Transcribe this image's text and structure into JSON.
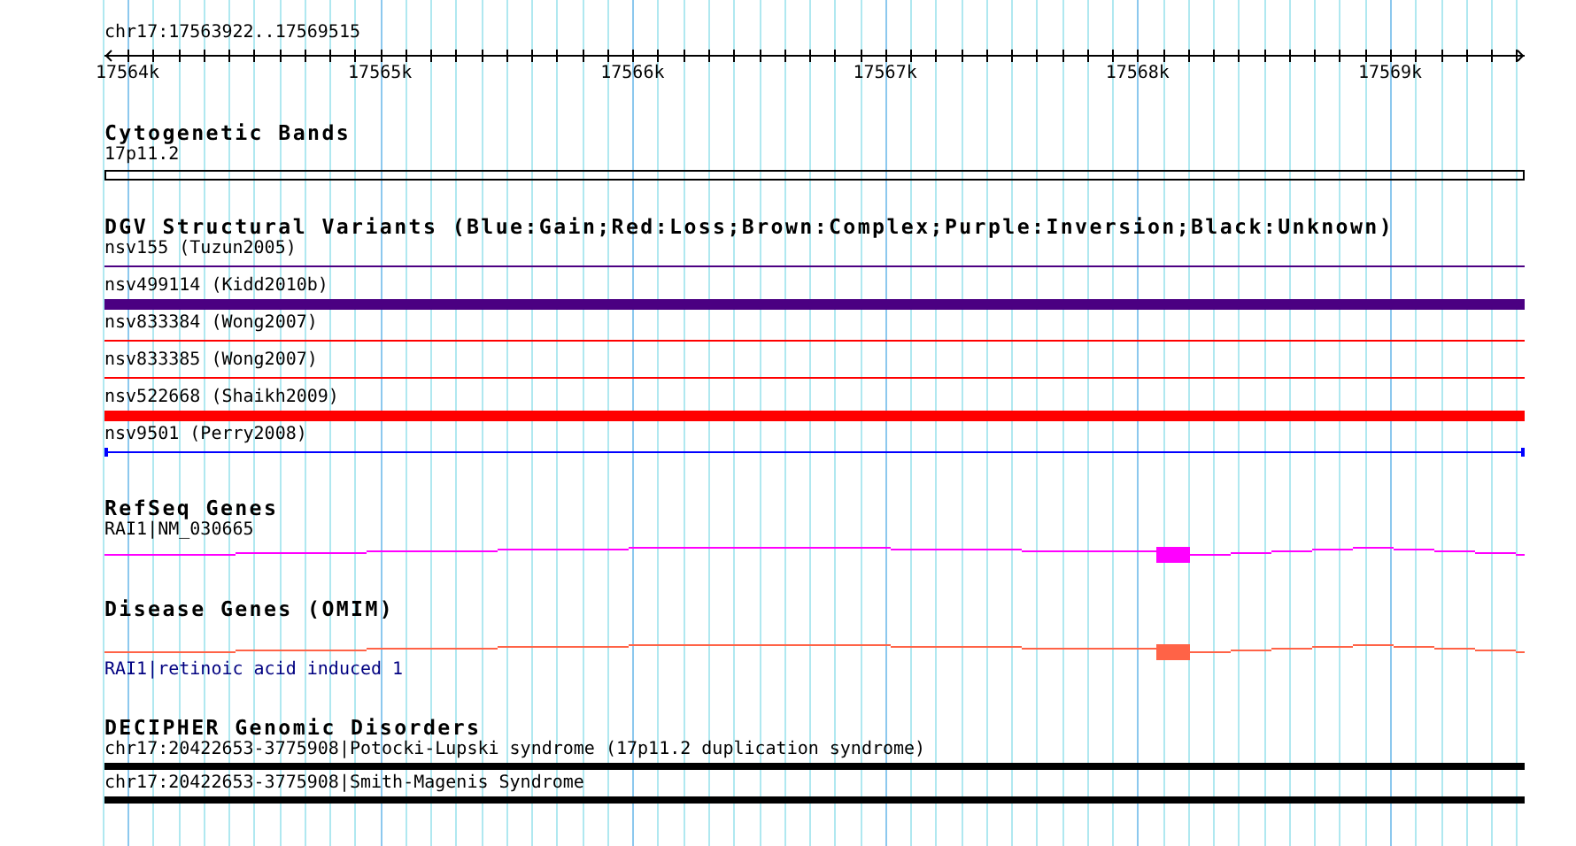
{
  "ruler": {
    "label": "chr17:17563922..17569515",
    "ticks": [
      "17564k",
      "17565k",
      "17566k",
      "17567k",
      "17568k",
      "17569k"
    ]
  },
  "tracks": [
    {
      "title": "Cytogenetic Bands",
      "features": [
        {
          "kind": "band",
          "label": "17p11.2",
          "color": "#000000"
        }
      ]
    },
    {
      "title": "DGV Structural Variants (Blue:Gain;Red:Loss;Brown:Complex;Purple:Inversion;Black:Unknown)",
      "features": [
        {
          "kind": "thin",
          "label": "nsv155 (Tuzun2005)",
          "color": "#4b0082"
        },
        {
          "kind": "thick",
          "label": "nsv499114 (Kidd2010b)",
          "color": "#4b0082"
        },
        {
          "kind": "thin",
          "label": "nsv833384 (Wong2007)",
          "color": "#ff0000"
        },
        {
          "kind": "thin",
          "label": "nsv833385 (Wong2007)",
          "color": "#ff0000"
        },
        {
          "kind": "thick",
          "label": "nsv522668 (Shaikh2009)",
          "color": "#ff0000"
        },
        {
          "kind": "range",
          "label": "nsv9501 (Perry2008)",
          "color": "#0000ff"
        }
      ]
    },
    {
      "title": "RefSeq Genes",
      "features": [
        {
          "kind": "gene",
          "label": "RAI1|NM_030665",
          "color": "#ff00ff"
        }
      ]
    },
    {
      "title": "Disease Genes (OMIM)",
      "features": [
        {
          "kind": "gene_below",
          "label": "RAI1|retinoic acid induced 1",
          "color": "#ff6347"
        }
      ]
    },
    {
      "title": "DECIPHER Genomic Disorders",
      "features": [
        {
          "kind": "bar",
          "label": "chr17:20422653-3775908|Potocki-Lupski syndrome (17p11.2 duplication syndrome)",
          "color": "#000000"
        },
        {
          "kind": "bar",
          "label": "chr17:20422653-3775908|Smith-Magenis Syndrome",
          "color": "#000000"
        }
      ]
    }
  ]
}
